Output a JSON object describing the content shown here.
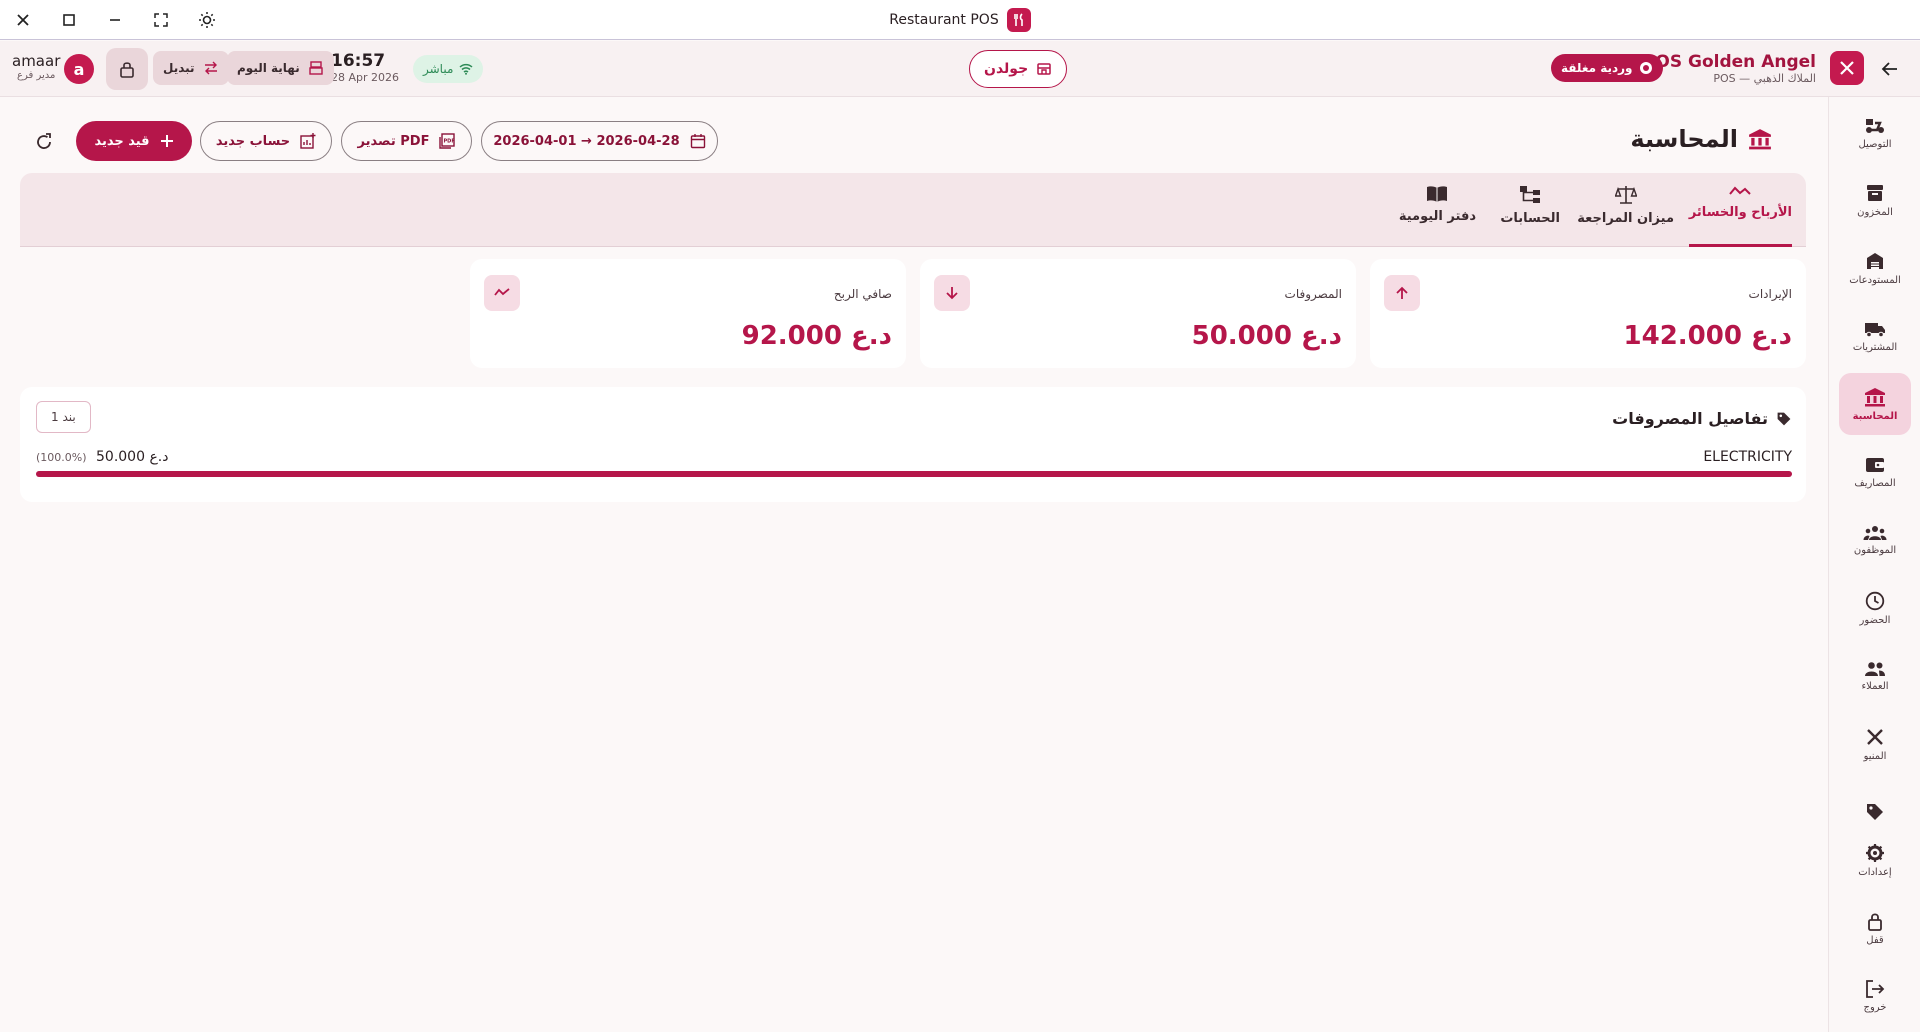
{
  "window": {
    "title": "Restaurant POS"
  },
  "header": {
    "brand_name": "POS Golden Angel",
    "brand_sub": "POS — الملاك الذهبي",
    "shift_status": "وردية مغلقة",
    "branch": "جولدن",
    "connection": "مباشر",
    "time": "16:57",
    "date": "28 Apr 2026",
    "end_of_day": "نهاية اليوم",
    "switch": "تبديل",
    "avatar_letter": "a",
    "user_name": "amaar",
    "user_role": "مدير فرع"
  },
  "sidebar": {
    "items": [
      {
        "label": "التوصيل",
        "icon": "delivery-icon"
      },
      {
        "label": "المخزون",
        "icon": "inventory-icon"
      },
      {
        "label": "المستودعات",
        "icon": "warehouse-icon"
      },
      {
        "label": "المشتريات",
        "icon": "truck-icon"
      },
      {
        "label": "المحاسبة",
        "icon": "bank-icon",
        "active": true
      },
      {
        "label": "المصاريف",
        "icon": "wallet-icon"
      },
      {
        "label": "الموظفون",
        "icon": "staff-icon"
      },
      {
        "label": "الحضور",
        "icon": "clock-icon"
      },
      {
        "label": "العملاء",
        "icon": "customers-icon"
      },
      {
        "label": "المنيو",
        "icon": "menu-icon"
      },
      {
        "label": "",
        "icon": "tag-icon"
      },
      {
        "label": "إعدادات",
        "icon": "gear-icon"
      },
      {
        "label": "قفل",
        "icon": "lock-icon"
      },
      {
        "label": "خروج",
        "icon": "logout-icon"
      }
    ]
  },
  "page": {
    "title": "المحاسبة",
    "date_range": "2026-04-01 → 2026-04-28",
    "export_pdf": "تصدير PDF",
    "new_account": "حساب جديد",
    "new_entry": "قيد جديد"
  },
  "tabs": [
    {
      "label": "الأرباح والخسائر",
      "icon": "trending-icon",
      "active": true
    },
    {
      "label": "ميزان المراجعة",
      "icon": "scale-icon"
    },
    {
      "label": "الحسابات",
      "icon": "tree-icon"
    },
    {
      "label": "دفتر اليومية",
      "icon": "book-icon"
    }
  ],
  "summary": {
    "revenue": {
      "label": "الإيرادات",
      "value": "142.000 د.ع"
    },
    "expenses": {
      "label": "المصروفات",
      "value": "50.000 د.ع"
    },
    "net_profit": {
      "label": "صافي الربح",
      "value": "92.000 د.ع"
    }
  },
  "expense_details": {
    "title": "تفاصيل المصروفات",
    "count": "1 بند",
    "rows": [
      {
        "name": "ELECTRICITY",
        "amount": "50.000 د.ع",
        "percent": "(100.0%)",
        "share": 1.0
      }
    ]
  },
  "colors": {
    "accent": "#b5164a",
    "accent_light": "#f4d3de",
    "live": "#2e8b57"
  }
}
